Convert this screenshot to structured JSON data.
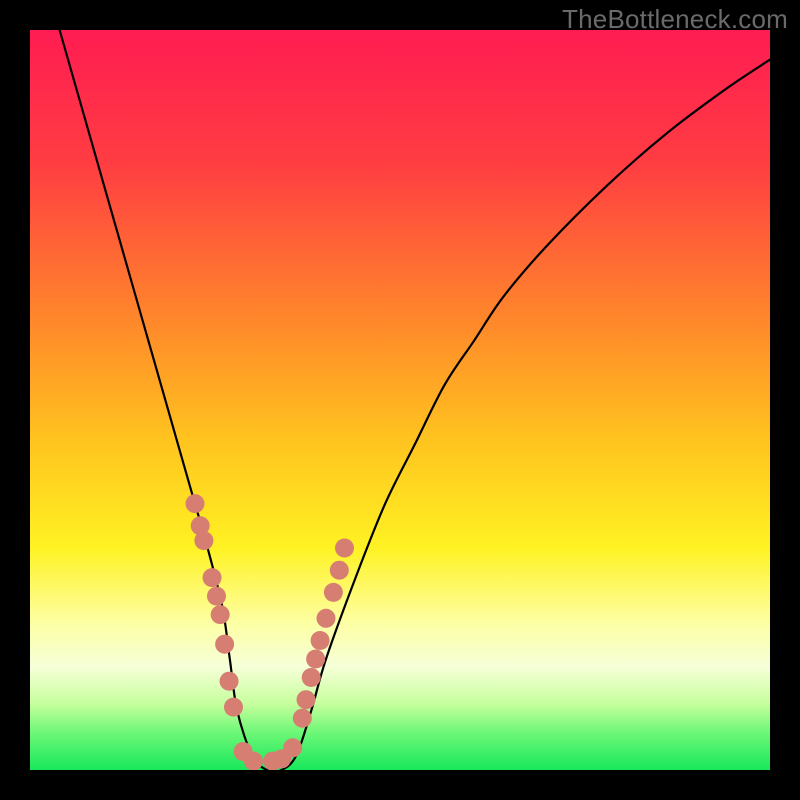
{
  "watermark": "TheBottleneck.com",
  "chart_data": {
    "type": "line",
    "title": "",
    "xlabel": "",
    "ylabel": "",
    "xlim": [
      0,
      100
    ],
    "ylim": [
      0,
      100
    ],
    "series": [
      {
        "name": "curve",
        "x": [
          4,
          6,
          8,
          10,
          12,
          14,
          16,
          18,
          20,
          22,
          24,
          26,
          27,
          28,
          30,
          32,
          34,
          36,
          38,
          40,
          44,
          48,
          52,
          56,
          60,
          64,
          70,
          78,
          86,
          94,
          100
        ],
        "y": [
          100,
          93,
          86,
          79,
          72,
          65,
          58,
          51,
          44,
          37,
          30,
          22,
          15,
          8,
          2,
          0,
          0,
          2,
          8,
          15,
          26,
          36,
          44,
          52,
          58,
          64,
          71,
          79,
          86,
          92,
          96
        ]
      }
    ],
    "markers": {
      "name": "points",
      "color_hex": "#d77e72",
      "x": [
        22.3,
        23.0,
        23.5,
        24.6,
        25.2,
        25.7,
        26.3,
        26.9,
        27.5,
        28.8,
        30.2,
        32.8,
        34.0,
        35.5,
        36.8,
        37.3,
        38.0,
        38.6,
        39.2,
        40.0,
        41.0,
        41.8,
        42.5
      ],
      "y": [
        36.0,
        33.0,
        31.0,
        26.0,
        23.5,
        21.0,
        17.0,
        12.0,
        8.5,
        2.5,
        1.2,
        1.2,
        1.5,
        3.0,
        7.0,
        9.5,
        12.5,
        15.0,
        17.5,
        20.5,
        24.0,
        27.0,
        30.0
      ]
    },
    "background_gradient": {
      "stops": [
        {
          "offset": 0.0,
          "color": "#ff1c52"
        },
        {
          "offset": 0.18,
          "color": "#ff3d42"
        },
        {
          "offset": 0.4,
          "color": "#ff8a2a"
        },
        {
          "offset": 0.55,
          "color": "#ffc21f"
        },
        {
          "offset": 0.7,
          "color": "#fff223"
        },
        {
          "offset": 0.8,
          "color": "#fdffa2"
        },
        {
          "offset": 0.86,
          "color": "#f6ffd8"
        },
        {
          "offset": 0.91,
          "color": "#c7ff9e"
        },
        {
          "offset": 0.95,
          "color": "#6cf777"
        },
        {
          "offset": 1.0,
          "color": "#18e85b"
        }
      ]
    }
  }
}
